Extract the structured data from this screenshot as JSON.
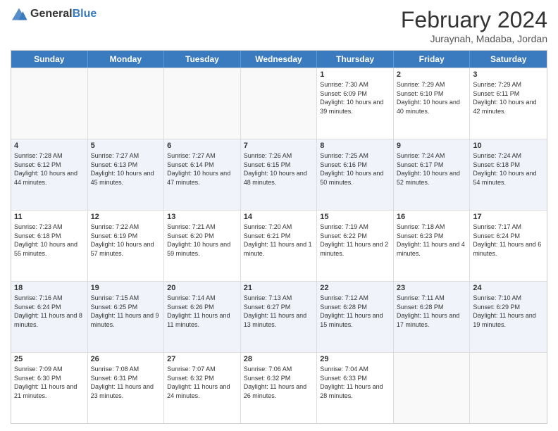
{
  "header": {
    "logo": {
      "general": "General",
      "blue": "Blue"
    },
    "title": "February 2024",
    "subtitle": "Juraynah, Madaba, Jordan"
  },
  "days_of_week": [
    "Sunday",
    "Monday",
    "Tuesday",
    "Wednesday",
    "Thursday",
    "Friday",
    "Saturday"
  ],
  "weeks": [
    [
      {
        "day": "",
        "info": ""
      },
      {
        "day": "",
        "info": ""
      },
      {
        "day": "",
        "info": ""
      },
      {
        "day": "",
        "info": ""
      },
      {
        "day": "1",
        "info": "Sunrise: 7:30 AM\nSunset: 6:09 PM\nDaylight: 10 hours and 39 minutes."
      },
      {
        "day": "2",
        "info": "Sunrise: 7:29 AM\nSunset: 6:10 PM\nDaylight: 10 hours and 40 minutes."
      },
      {
        "day": "3",
        "info": "Sunrise: 7:29 AM\nSunset: 6:11 PM\nDaylight: 10 hours and 42 minutes."
      }
    ],
    [
      {
        "day": "4",
        "info": "Sunrise: 7:28 AM\nSunset: 6:12 PM\nDaylight: 10 hours and 44 minutes."
      },
      {
        "day": "5",
        "info": "Sunrise: 7:27 AM\nSunset: 6:13 PM\nDaylight: 10 hours and 45 minutes."
      },
      {
        "day": "6",
        "info": "Sunrise: 7:27 AM\nSunset: 6:14 PM\nDaylight: 10 hours and 47 minutes."
      },
      {
        "day": "7",
        "info": "Sunrise: 7:26 AM\nSunset: 6:15 PM\nDaylight: 10 hours and 48 minutes."
      },
      {
        "day": "8",
        "info": "Sunrise: 7:25 AM\nSunset: 6:16 PM\nDaylight: 10 hours and 50 minutes."
      },
      {
        "day": "9",
        "info": "Sunrise: 7:24 AM\nSunset: 6:17 PM\nDaylight: 10 hours and 52 minutes."
      },
      {
        "day": "10",
        "info": "Sunrise: 7:24 AM\nSunset: 6:18 PM\nDaylight: 10 hours and 54 minutes."
      }
    ],
    [
      {
        "day": "11",
        "info": "Sunrise: 7:23 AM\nSunset: 6:18 PM\nDaylight: 10 hours and 55 minutes."
      },
      {
        "day": "12",
        "info": "Sunrise: 7:22 AM\nSunset: 6:19 PM\nDaylight: 10 hours and 57 minutes."
      },
      {
        "day": "13",
        "info": "Sunrise: 7:21 AM\nSunset: 6:20 PM\nDaylight: 10 hours and 59 minutes."
      },
      {
        "day": "14",
        "info": "Sunrise: 7:20 AM\nSunset: 6:21 PM\nDaylight: 11 hours and 1 minute."
      },
      {
        "day": "15",
        "info": "Sunrise: 7:19 AM\nSunset: 6:22 PM\nDaylight: 11 hours and 2 minutes."
      },
      {
        "day": "16",
        "info": "Sunrise: 7:18 AM\nSunset: 6:23 PM\nDaylight: 11 hours and 4 minutes."
      },
      {
        "day": "17",
        "info": "Sunrise: 7:17 AM\nSunset: 6:24 PM\nDaylight: 11 hours and 6 minutes."
      }
    ],
    [
      {
        "day": "18",
        "info": "Sunrise: 7:16 AM\nSunset: 6:24 PM\nDaylight: 11 hours and 8 minutes."
      },
      {
        "day": "19",
        "info": "Sunrise: 7:15 AM\nSunset: 6:25 PM\nDaylight: 11 hours and 9 minutes."
      },
      {
        "day": "20",
        "info": "Sunrise: 7:14 AM\nSunset: 6:26 PM\nDaylight: 11 hours and 11 minutes."
      },
      {
        "day": "21",
        "info": "Sunrise: 7:13 AM\nSunset: 6:27 PM\nDaylight: 11 hours and 13 minutes."
      },
      {
        "day": "22",
        "info": "Sunrise: 7:12 AM\nSunset: 6:28 PM\nDaylight: 11 hours and 15 minutes."
      },
      {
        "day": "23",
        "info": "Sunrise: 7:11 AM\nSunset: 6:28 PM\nDaylight: 11 hours and 17 minutes."
      },
      {
        "day": "24",
        "info": "Sunrise: 7:10 AM\nSunset: 6:29 PM\nDaylight: 11 hours and 19 minutes."
      }
    ],
    [
      {
        "day": "25",
        "info": "Sunrise: 7:09 AM\nSunset: 6:30 PM\nDaylight: 11 hours and 21 minutes."
      },
      {
        "day": "26",
        "info": "Sunrise: 7:08 AM\nSunset: 6:31 PM\nDaylight: 11 hours and 23 minutes."
      },
      {
        "day": "27",
        "info": "Sunrise: 7:07 AM\nSunset: 6:32 PM\nDaylight: 11 hours and 24 minutes."
      },
      {
        "day": "28",
        "info": "Sunrise: 7:06 AM\nSunset: 6:32 PM\nDaylight: 11 hours and 26 minutes."
      },
      {
        "day": "29",
        "info": "Sunrise: 7:04 AM\nSunset: 6:33 PM\nDaylight: 11 hours and 28 minutes."
      },
      {
        "day": "",
        "info": ""
      },
      {
        "day": "",
        "info": ""
      }
    ]
  ]
}
